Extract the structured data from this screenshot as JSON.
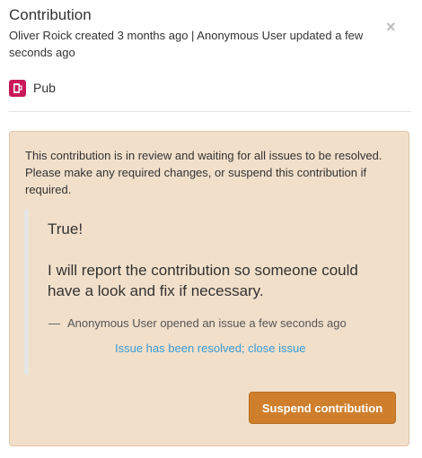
{
  "header": {
    "title": "Contribution",
    "meta": "Oliver Roick created 3 months ago | Anonymous User updated a few seconds ago",
    "close_label": "×"
  },
  "venue": {
    "icon": "beer-mug-icon",
    "icon_color": "#c8195a",
    "label": "Pub"
  },
  "review": {
    "message": "This contribution is in review and waiting for all issues to be resolved. Please make any required changes, or suspend this contribution if required.",
    "quote_line1": "True!",
    "quote_line2": "I will report the contribution so someone could have a look and fix if necessary.",
    "quote_dash": "—",
    "quote_footer": "Anonymous User opened an issue a few seconds ago",
    "resolve_link": "Issue has been resolved; close issue",
    "suspend_button": "Suspend contribution"
  },
  "colors": {
    "review_bg": "#f1dfca",
    "button_bg": "#cf7f2b",
    "link": "#3a9bd5"
  }
}
